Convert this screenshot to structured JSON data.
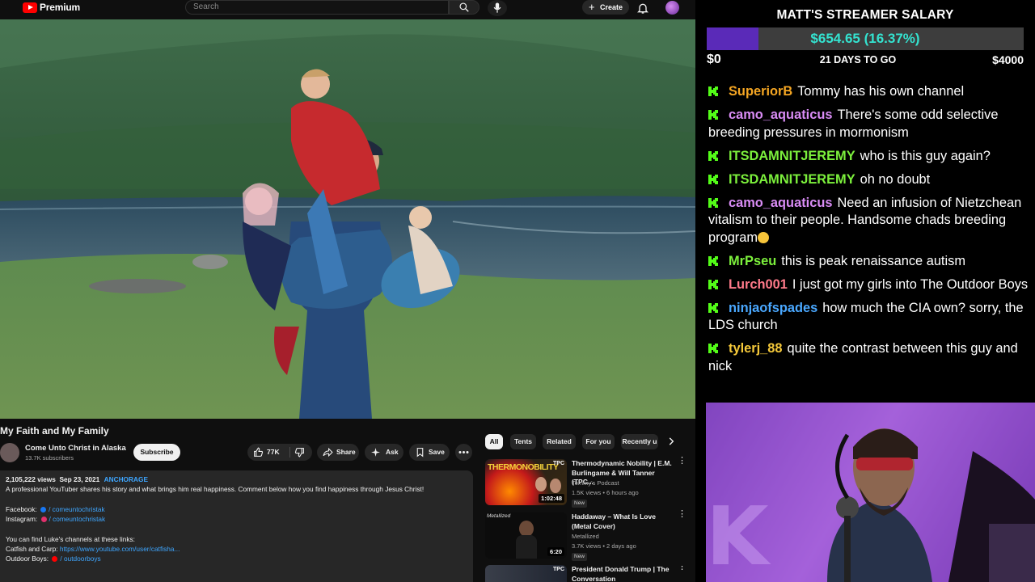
{
  "youtube": {
    "logo_text": "Premium",
    "search_placeholder": "Search",
    "create_label": "Create",
    "video": {
      "title": "My Faith and My Family",
      "channel": "Come Unto Christ in Alaska",
      "subscribers": "13.7K subscribers",
      "subscribe_label": "Subscribe",
      "likes": "77K",
      "share_label": "Share",
      "ask_label": "Ask",
      "save_label": "Save"
    },
    "description": {
      "views": "2,105,222 views",
      "date": "Sep 23, 2021",
      "hashtag": "ANCHORAGE",
      "text": "A professional YouTuber shares his story and what brings him real happiness. Comment below how you find happiness through Jesus Christ!",
      "facebook_label": "Facebook:",
      "facebook_handle": "/ comeuntochristak",
      "instagram_label": "Instagram:",
      "instagram_handle": "/ comeuntochristak",
      "channels_text": "You can find Luke's channels at these links:",
      "catfish_label": "Catfish and Carp:",
      "catfish_link": "https://www.youtube.com/user/catfisha...",
      "outdoor_label": "Outdoor Boys:",
      "outdoor_handle": "/ outdoorboys"
    },
    "chips": [
      "All",
      "Tents",
      "Related",
      "For you",
      "Recently u"
    ],
    "related": [
      {
        "title": "Thermodynamic Nobility | E.M. Burlingame & Will Tanner (TPC...",
        "channel": "Tommy's Podcast",
        "meta": "1.5K views • 6 hours ago",
        "badge": "New",
        "duration": "1:02:48",
        "thumb_text": "THERMONOBILITY",
        "thumb_tag": "TPC"
      },
      {
        "title": "Haddaway – What Is Love (Metal Cover)",
        "channel": "Metallized",
        "meta": "3.7K views • 2 days ago",
        "badge": "New",
        "duration": "6:20",
        "thumb_text": "Metallized"
      },
      {
        "title": "President Donald Trump | The Conversation",
        "channel": "",
        "meta": "",
        "badge": "",
        "duration": "",
        "thumb_tag": "TPC"
      }
    ]
  },
  "overlay": {
    "salary_title": "MATT'S STREAMER SALARY",
    "salary_amount": "$654.65 (16.37%)",
    "salary_progress": 0.1637,
    "salary_min": "$0",
    "salary_days": "21 DAYS TO GO",
    "salary_max": "$4000",
    "chat": [
      {
        "user": "SuperiorB",
        "color": "#f5a623",
        "text": "Tommy has his own channel"
      },
      {
        "user": "camo_aquaticus",
        "color": "#d98cf5",
        "text": "There's some odd selective breeding pressures in mormonism"
      },
      {
        "user": "ITSDAMNITJEREMY",
        "color": "#7cf03c",
        "text": "who is this guy again?"
      },
      {
        "user": "ITSDAMNITJEREMY",
        "color": "#7cf03c",
        "text": "oh no doubt"
      },
      {
        "user": "camo_aquaticus",
        "color": "#d98cf5",
        "text": "Need an infusion of Nietzchean vitalism to their people. Handsome chads breeding program"
      },
      {
        "user": "MrPseu",
        "color": "#7cf03c",
        "text": "this is peak renaissance autism"
      },
      {
        "user": "Lurch001",
        "color": "#ff7a8a",
        "text": "I just got my girls into The Outdoor Boys"
      },
      {
        "user": "ninjaofspades",
        "color": "#4aa8ff",
        "text": "how much the CIA own? sorry, the LDS church"
      },
      {
        "user": "tylerj_88",
        "color": "#f5c93a",
        "text": "quite the contrast between this guy and nick"
      }
    ],
    "colors": {
      "kick_green": "#53fc18",
      "chat_text": "#ffffff",
      "amount": "#34e3d0",
      "bar_fill": "#5a2ab8"
    }
  }
}
